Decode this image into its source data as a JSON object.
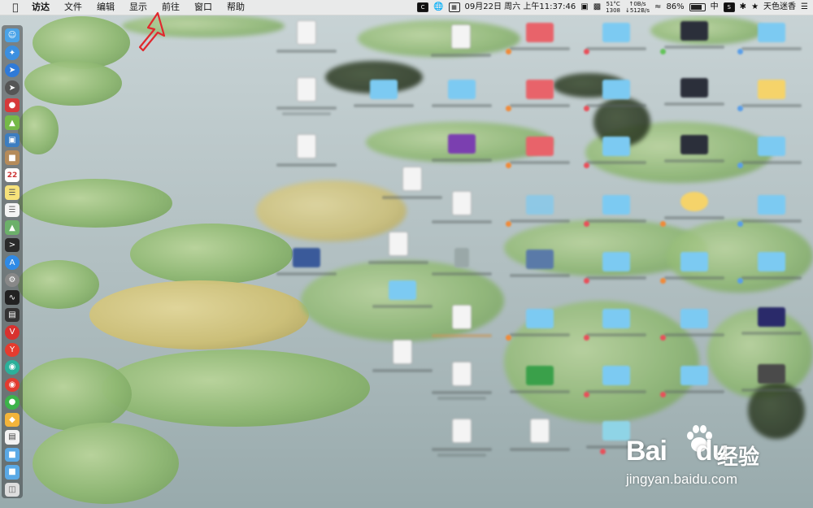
{
  "menubar": {
    "app_name": "访达",
    "menus": [
      "文件",
      "编辑",
      "显示",
      "前往",
      "窗口",
      "帮助"
    ],
    "status": {
      "temp_top": "51°C",
      "temp_bottom": "1308",
      "net_up": "↑0B/s",
      "net_down": "↓512B/s",
      "datetime": "09月22日 周六 上午11:37:46",
      "battery": "86%",
      "battery_level": 0.86,
      "input_method": "中",
      "user": "天色迷香"
    }
  },
  "dock": {
    "icons": [
      "finder-icon",
      "safari-icon",
      "launchpad-icon",
      "app-icon",
      "android-icon",
      "preview-icon",
      "contacts-icon",
      "calendar-icon",
      "notes-icon",
      "maps-icon",
      "terminal-icon",
      "appstore-icon",
      "settings-icon",
      "activity-icon",
      "console-icon",
      "vivaldi-icon",
      "yandex-icon",
      "browser-icon",
      "weibo-icon",
      "wechat-icon",
      "sketch-icon",
      "textedit-icon",
      "folder-icon",
      "folder-icon-2",
      "trash-icon"
    ],
    "calendar_day": "22"
  },
  "watermark": {
    "logo": "Bai",
    "logo2": "du",
    "cn": "经验",
    "url": "jingyan.baidu.com"
  },
  "colors": {
    "folder": "#7ccaf2",
    "annotation": "#e0292e"
  }
}
